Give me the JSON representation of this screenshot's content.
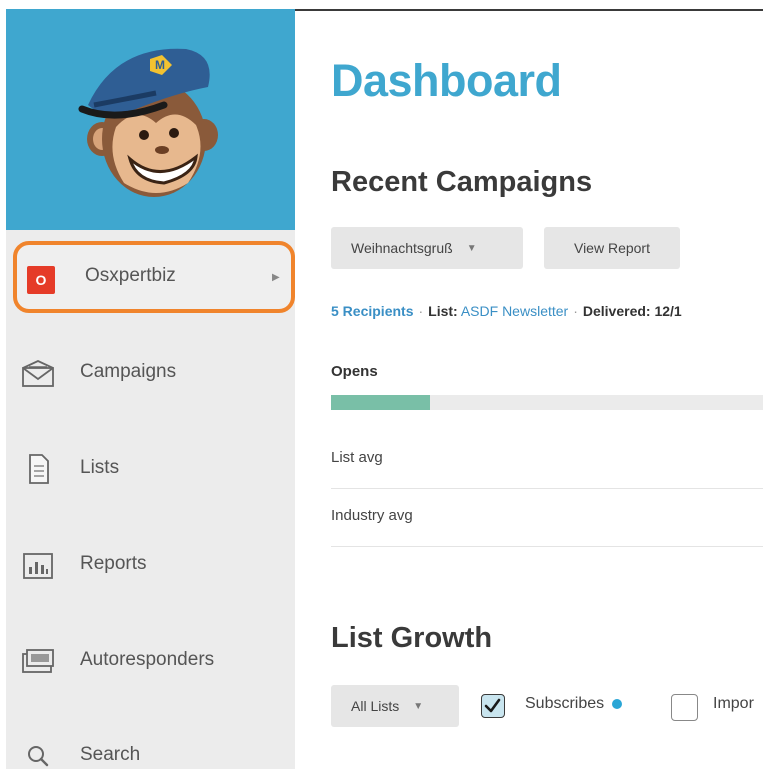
{
  "sidebar": {
    "account": {
      "badge": "O",
      "name": "Osxpertbiz"
    },
    "items": [
      {
        "label": "Campaigns",
        "icon": "envelope-icon"
      },
      {
        "label": "Lists",
        "icon": "document-icon"
      },
      {
        "label": "Reports",
        "icon": "bar-chart-icon"
      },
      {
        "label": "Autoresponders",
        "icon": "autoresponder-icon"
      },
      {
        "label": "Search",
        "icon": "search-icon"
      }
    ]
  },
  "main": {
    "title": "Dashboard",
    "recent_campaigns": {
      "heading": "Recent Campaigns",
      "campaign_select": "Weihnachtsgruß",
      "view_report_label": "View Report",
      "meta": {
        "recipients": "5 Recipients",
        "list_label": "List:",
        "list_name": "ASDF Newsletter",
        "delivered_label": "Delivered:",
        "delivered_value": "12/1"
      },
      "opens_label": "Opens",
      "opens_fill": 0.23,
      "rows": [
        "List avg",
        "Industry avg"
      ]
    },
    "list_growth": {
      "heading": "List Growth",
      "list_select": "All Lists",
      "subscribes_label": "Subscribes",
      "imports_label": "Impor"
    }
  },
  "colors": {
    "accent": "#3fa7cf",
    "highlight": "#f0842c",
    "badge": "#e53b28",
    "bar_fill": "#79bfa7"
  }
}
